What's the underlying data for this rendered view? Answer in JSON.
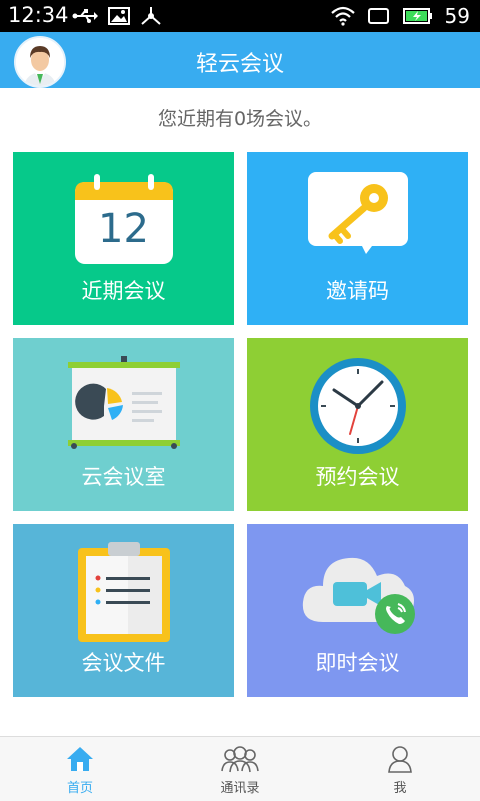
{
  "status_bar": {
    "time": "12:34",
    "battery": "59"
  },
  "app_bar": {
    "title": "轻云会议"
  },
  "notice": "您近期有0场会议。",
  "tiles": [
    {
      "label": "近期会议",
      "color": "#06c98a",
      "calendar_day": "12"
    },
    {
      "label": "邀请码",
      "color": "#2fb0f5"
    },
    {
      "label": "云会议室",
      "color": "#6fcfcf"
    },
    {
      "label": "预约会议",
      "color": "#8ecf34"
    },
    {
      "label": "会议文件",
      "color": "#57b5d8"
    },
    {
      "label": "即时会议",
      "color": "#7e97f0"
    }
  ],
  "tabs": [
    {
      "label": "首页",
      "active": true
    },
    {
      "label": "通讯录",
      "active": false
    },
    {
      "label": "我",
      "active": false
    }
  ],
  "accent": "#38acf0"
}
